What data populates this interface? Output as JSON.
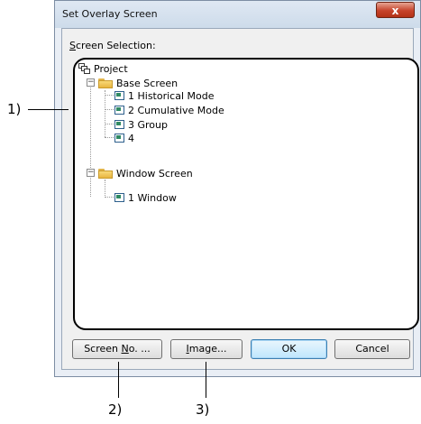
{
  "dialog": {
    "title": "Set Overlay Screen",
    "close_glyph": "x",
    "screen_selection_label_prefix": "S",
    "screen_selection_label_rest": "creen Selection:"
  },
  "tree": {
    "root": "Project",
    "base_screen": {
      "label": "Base Screen",
      "expander": "−",
      "items": [
        "1 Historical Mode",
        "2 Cumulative Mode",
        "3 Group",
        "4"
      ]
    },
    "window_screen": {
      "label": "Window Screen",
      "expander": "−",
      "items": [
        "1 Window"
      ]
    }
  },
  "buttons": {
    "screen_no_prefix": "Screen ",
    "screen_no_mnemonic": "N",
    "screen_no_rest": "o. ...",
    "image_mnemonic": "I",
    "image_rest": "mage...",
    "ok": "OK",
    "cancel": "Cancel"
  },
  "callouts": {
    "tree": "1)",
    "screen_no": "2)",
    "image": "3)"
  }
}
